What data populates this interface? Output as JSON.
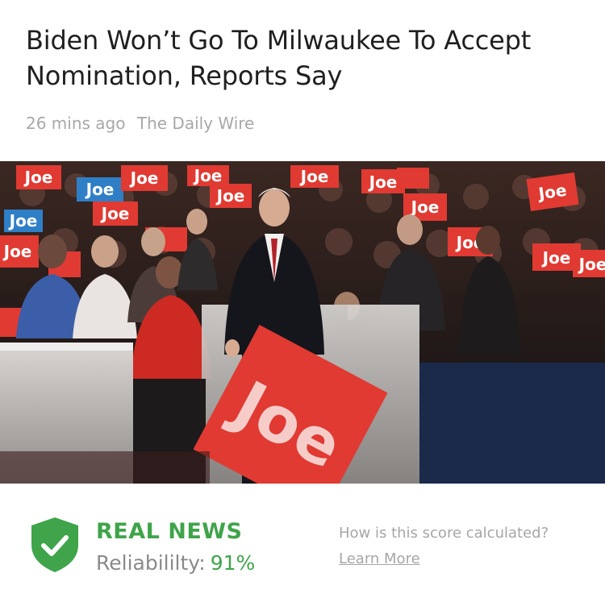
{
  "article": {
    "title": "Biden Won’t Go To Milwaukee To Accept Nomination, Reports Say",
    "time_ago": "26 mins ago",
    "source": "The Daily Wire"
  },
  "photo": {
    "sign_text": "Joe",
    "colors": {
      "sign_red": "#e03a32",
      "sign_blue": "#2f7fc7"
    }
  },
  "rating": {
    "verdict": "REAL NEWS",
    "reliability_label": "Reliabililty:",
    "reliability_value": "91%",
    "icon": "shield-check-icon",
    "colors": {
      "accent_green": "#3fa44a"
    }
  },
  "help": {
    "question": "How is this score calculated?",
    "link_label": "Learn More"
  }
}
